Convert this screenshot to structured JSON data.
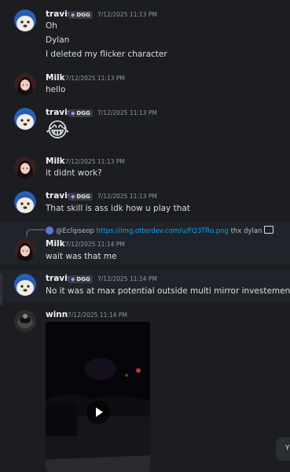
{
  "users": {
    "travis": {
      "name": "travis",
      "tag": "DGG"
    },
    "milk": {
      "name": "Milk"
    },
    "winn": {
      "name": "winn"
    }
  },
  "messages": [
    {
      "author": "travis",
      "timestamp": "7/12/2025 11:13 PM",
      "lines": [
        "Oh",
        "Dylan",
        "I deleted my flicker character"
      ]
    },
    {
      "author": "Milk",
      "timestamp": "7/12/2025 11:13 PM",
      "lines": [
        "hello"
      ]
    },
    {
      "author": "travis",
      "timestamp": "7/12/2025 11:13 PM",
      "emoji": "😂"
    },
    {
      "author": "Milk",
      "timestamp": "7/12/2025 11:13 PM",
      "lines": [
        "it didnt work?"
      ]
    },
    {
      "author": "travis",
      "timestamp": "7/12/2025 11:13 PM",
      "lines": [
        "That skill is ass idk how u play that"
      ]
    },
    {
      "author": "Milk",
      "timestamp": "7/12/2025 11:14 PM",
      "lines": [
        "wait was that me"
      ],
      "reply": {
        "user": "@Eclipseop",
        "link": "https://img.otterdev.com/u/FQ3TRo.png",
        "text": "thx dylan"
      }
    },
    {
      "author": "travis",
      "timestamp": "7/12/2025 11:14 PM",
      "lines": [
        "No it was at max potential outside multi mirror investement"
      ]
    },
    {
      "author": "winn",
      "timestamp": "7/12/2025 11:14 PM",
      "attachment": "video"
    }
  ],
  "corner_button": {
    "label": "Y"
  },
  "colors": {
    "background": "#1b1d20",
    "link": "#00a8fc",
    "tag_bg": "#3a3c44"
  }
}
